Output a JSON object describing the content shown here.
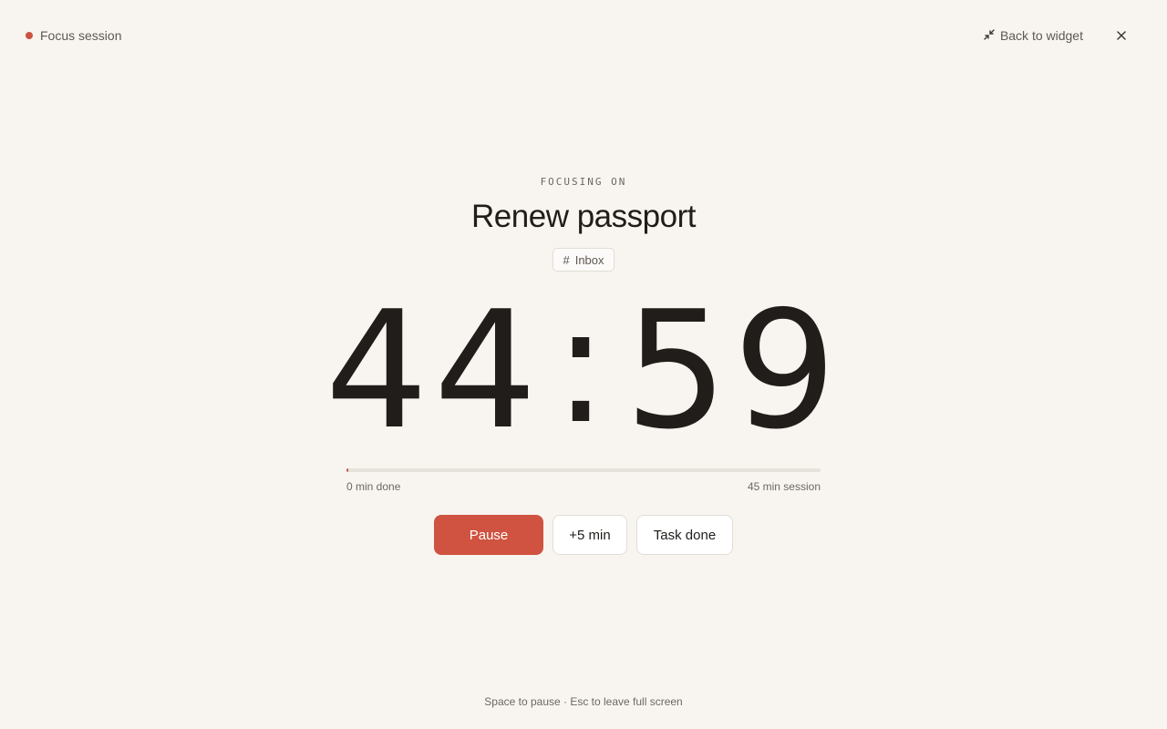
{
  "header": {
    "session_label": "Focus session",
    "back_to_widget": "Back to widget"
  },
  "focus": {
    "eyebrow": "FOCUSING ON",
    "task_title": "Renew passport",
    "tag": "Inbox"
  },
  "timer": {
    "minutes": "44",
    "seconds": "59",
    "separator": ":"
  },
  "progress": {
    "fraction": 0.004,
    "left_label": "0 min done",
    "right_label": "45 min session"
  },
  "controls": {
    "pause_label": "Pause",
    "add_time_label": "+5 min",
    "task_done_label": "Task done"
  },
  "hint": "Space to pause · Esc to leave full screen",
  "colors": {
    "accent": "#cf5340",
    "background": "#f8f5f0",
    "text": "#201d1a"
  },
  "icons": {
    "status": "recording-dot-icon",
    "back": "collapse-arrows-icon",
    "close": "close-icon",
    "tag": "hash-icon"
  }
}
